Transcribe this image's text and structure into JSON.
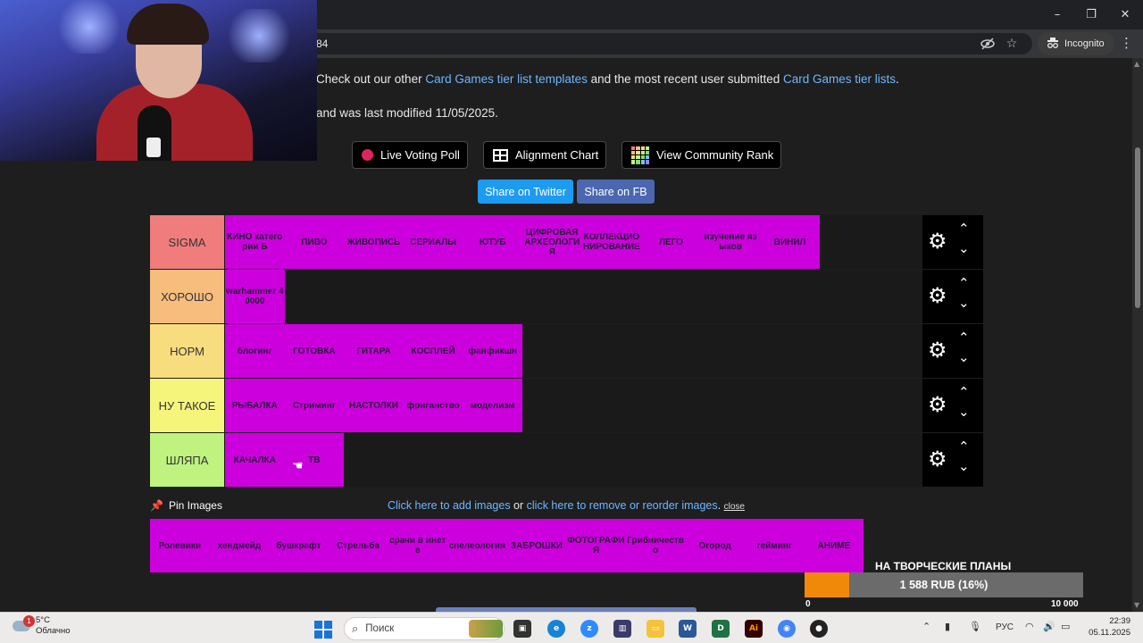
{
  "browser": {
    "url_fragment": "84",
    "incognito_label": "Incognito",
    "window_controls": {
      "minimize": "–",
      "maximize": "❐",
      "close": "✕"
    }
  },
  "page": {
    "intro": {
      "prefix": "Check out our other ",
      "link1": "Card Games tier list templates",
      "middle": " and the most recent user submitted ",
      "link2": "Card Games tier lists",
      "suffix": "."
    },
    "modified": "and was last modified 11/05/2025.",
    "buttons": {
      "poll": "Live Voting Poll",
      "alignment": "Alignment Chart",
      "community": "View Community Rank"
    },
    "share": {
      "twitter": "Share on Twitter",
      "fb": "Share on FB"
    }
  },
  "tiers": [
    {
      "label": "SIGMA",
      "color": "#f07c7c",
      "items": [
        "КИНО категории Б",
        "ПИВО",
        "ЖИВОПИСЬ",
        "СЕРИАЛЫ",
        "ЮТУБ",
        "ЦИФРОВАЯ АРХЕОЛОГИЯ",
        "КОЛЛЕКЦИОНИРОВАНИЕ",
        "ЛЕГО",
        "изучение языков",
        "ВИНИЛ"
      ]
    },
    {
      "label": "ХОРОШО",
      "color": "#f7bd7d",
      "items": [
        "warhammer 40000"
      ]
    },
    {
      "label": "НОРМ",
      "color": "#f8dd7f",
      "items": [
        "блогинг",
        "ГОТОВКА",
        "ГИТАРА",
        "КОСПЛЕЙ",
        "фанфикшн"
      ]
    },
    {
      "label": "НУ ТАКОЕ",
      "color": "#f5f57c",
      "items": [
        "РЫБАЛКА",
        "Стриминг",
        "НАСТОЛКИ",
        "фриганство",
        "моделизм"
      ]
    },
    {
      "label": "ШЛЯПА",
      "color": "#bff27f",
      "items": [
        "КАЧАЛКА",
        "ТВ"
      ]
    }
  ],
  "pool": {
    "pin_label": "Pin Images",
    "add_link": "Click here to add images",
    "or": " or ",
    "remove_link": "click here to remove or reorder images",
    "dot": ".",
    "close": "close",
    "items": [
      "Ролевики",
      "хендмейд",
      "бушкрафт",
      "Стрельба",
      "срачи в инете",
      "спелеология",
      "ЗАБРОШКИ",
      "ФОТОГРАФИЯ",
      "Грибничество",
      "Огород",
      "гейминг",
      "АНИМЕ"
    ]
  },
  "donation_goal": {
    "title": "НА ТВОРЧЕСКИЕ ПЛАНЫ",
    "progress_text": "1 588 RUB (16%)",
    "progress_fraction": 0.16,
    "min": "0",
    "max": "10 000"
  },
  "taskbar": {
    "temperature": "5°C",
    "weather": "Облачно",
    "weather_badge": "1",
    "search_placeholder": "Поиск",
    "language": "РУС",
    "time": "22:39",
    "date": "05.11.2025"
  }
}
